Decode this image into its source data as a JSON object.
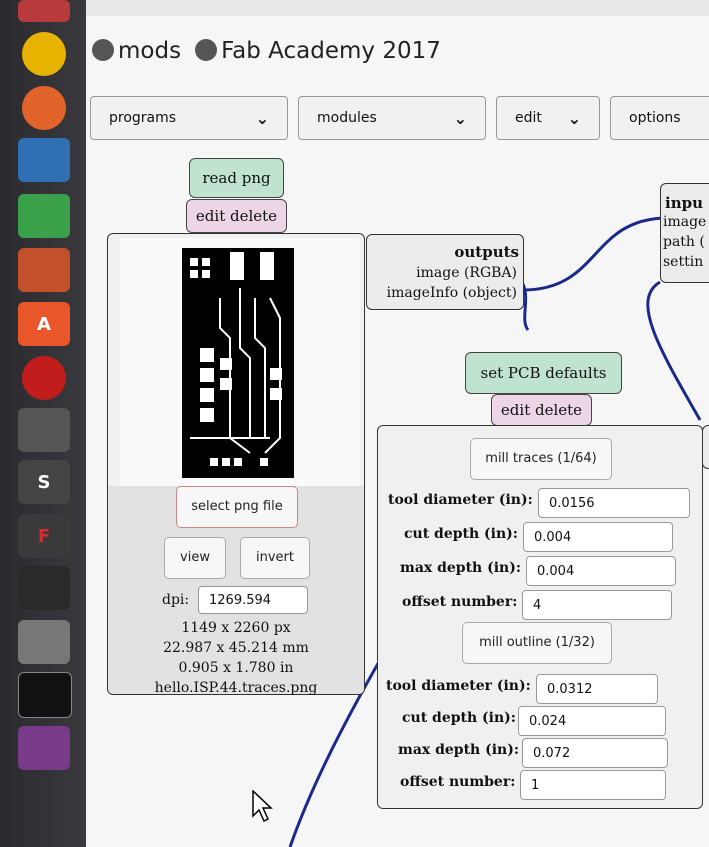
{
  "header": {
    "app_name": "mods",
    "academy": "Fab Academy 2017"
  },
  "menu": {
    "programs": "programs",
    "modules": "modules",
    "edit": "edit",
    "options": "options"
  },
  "read_png": {
    "title": "read png",
    "edit_delete": "edit delete",
    "select_label": "select png file",
    "view_label": "view",
    "invert_label": "invert",
    "dpi_label": "dpi:",
    "dpi_value": "1269.594",
    "px_size": "1149 x 2260 px",
    "mm_size": "22.987 x 45.214 mm",
    "in_size": "0.905 x 1.780 in",
    "filename": "hello.ISP.44.traces.png"
  },
  "outputs": {
    "title": "outputs",
    "image": "image (RGBA)",
    "image_info": "imageInfo (object)"
  },
  "pcb": {
    "title": "set PCB defaults",
    "edit_delete": "edit delete",
    "traces_button": "mill traces (1/64)",
    "outline_button": "mill outline (1/32)",
    "labels": {
      "tool_diameter": "tool diameter (in):",
      "cut_depth": "cut depth (in):",
      "max_depth": "max depth (in):",
      "offset_number": "offset number:"
    },
    "traces": {
      "tool_diameter": "0.0156",
      "cut_depth": "0.004",
      "max_depth": "0.004",
      "offset_number": "4"
    },
    "outline": {
      "tool_diameter": "0.0312",
      "cut_depth": "0.024",
      "max_depth": "0.072",
      "offset_number": "1"
    }
  },
  "inputs": {
    "title": "inpu",
    "image": "image",
    "path": "path (",
    "settings": "settin"
  },
  "colors": {
    "wire": "#1a2a8a",
    "green_button": "#bfe3cf",
    "pink_button": "#ecd6e6"
  }
}
